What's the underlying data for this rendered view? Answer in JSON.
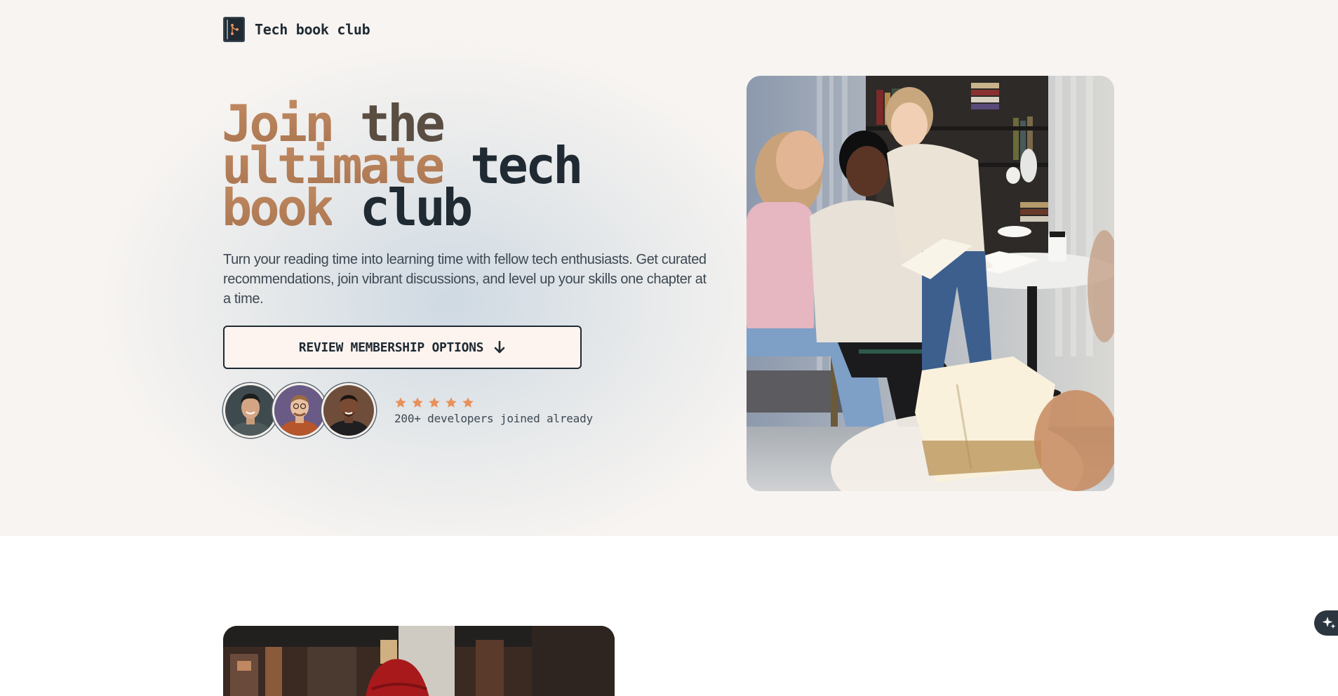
{
  "brand": {
    "name": "Tech book club",
    "logo_icon": "book-branch-icon"
  },
  "hero": {
    "headline": {
      "line1_accent": "Join",
      "line1_rest": "the",
      "line2_accent": "ultimate",
      "line2_rest": "tech",
      "line3_accent": "book",
      "line3_rest": "club"
    },
    "subtitle": "Turn your reading time into learning time with fellow tech enthusiasts. Get curated recommendations, join vibrant discussions, and level up your skills one chapter at a time.",
    "cta": {
      "label": "REVIEW MEMBERSHIP OPTIONS",
      "icon": "arrow-down-icon"
    },
    "social_proof": {
      "rating": 5,
      "rating_max": 5,
      "caption": "200+ developers joined already",
      "avatars": [
        "member-avatar-1",
        "member-avatar-2",
        "member-avatar-3"
      ]
    },
    "photo": "group-reading-photo"
  },
  "section2": {
    "photo": "reader-with-red-hat-photo"
  },
  "widget": {
    "icon": "sparkle-icon"
  },
  "colors": {
    "accent": "#b07a55",
    "dark": "#1f2a33",
    "star": "#e8915a",
    "cta_bg": "#fdf4ef",
    "hero_bg": "#f7f4f1"
  }
}
